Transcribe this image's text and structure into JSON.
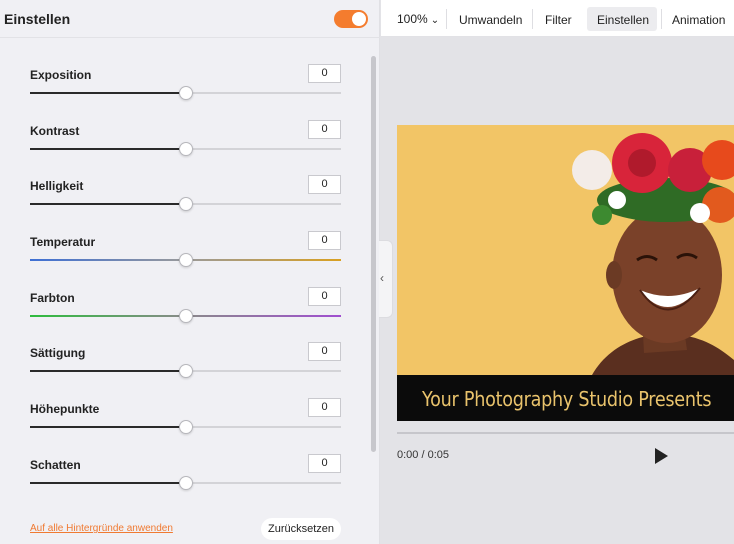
{
  "panel": {
    "title": "Einstellen",
    "toggle_on": true,
    "sliders": [
      {
        "label": "Exposition",
        "value": "0",
        "track": "black",
        "position": 50
      },
      {
        "label": "Kontrast",
        "value": "0",
        "track": "black",
        "position": 50
      },
      {
        "label": "Helligkeit",
        "value": "0",
        "track": "black",
        "position": 50
      },
      {
        "label": "Temperatur",
        "value": "0",
        "track": "temperature",
        "position": 50
      },
      {
        "label": "Farbton",
        "value": "0",
        "track": "hue",
        "position": 50
      },
      {
        "label": "Sättigung",
        "value": "0",
        "track": "black",
        "position": 50
      },
      {
        "label": "Höhepunkte",
        "value": "0",
        "track": "black",
        "position": 50
      },
      {
        "label": "Schatten",
        "value": "0",
        "track": "black",
        "position": 50
      }
    ],
    "apply_all_link": "Auf alle Hintergründe anwenden",
    "reset_button": "Zurücksetzen"
  },
  "toolbar": {
    "zoom": "100%",
    "convert": "Umwandeln",
    "filter": "Filter",
    "adjust": "Einstellen",
    "animation": "Animation"
  },
  "preview": {
    "caption": "Your Photography Studio Presents",
    "time": "0:00 / 0:05"
  },
  "colors": {
    "accent": "#f47c2e",
    "link": "#f07a32",
    "caption_text": "#e9c36c",
    "preview_background": "#f2c566"
  }
}
